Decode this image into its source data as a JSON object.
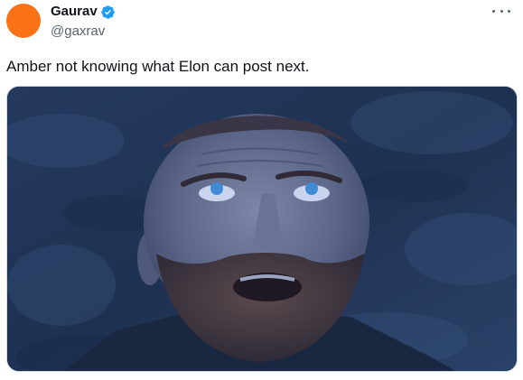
{
  "tweet": {
    "author": {
      "display_name": "Gaurav",
      "handle": "@gaxrav",
      "verified": true,
      "avatar_color": "#f97316"
    },
    "text": "Amber not knowing what Elon can post next.",
    "more_icon": "more-horizontal-icon",
    "verified_icon": "verified-badge-icon",
    "media_alt": "Man with a beard looking up in awe"
  },
  "colors": {
    "text_primary": "#0f1419",
    "text_secondary": "#536471",
    "verified_blue": "#1d9bf0",
    "border": "#cfd9de"
  }
}
